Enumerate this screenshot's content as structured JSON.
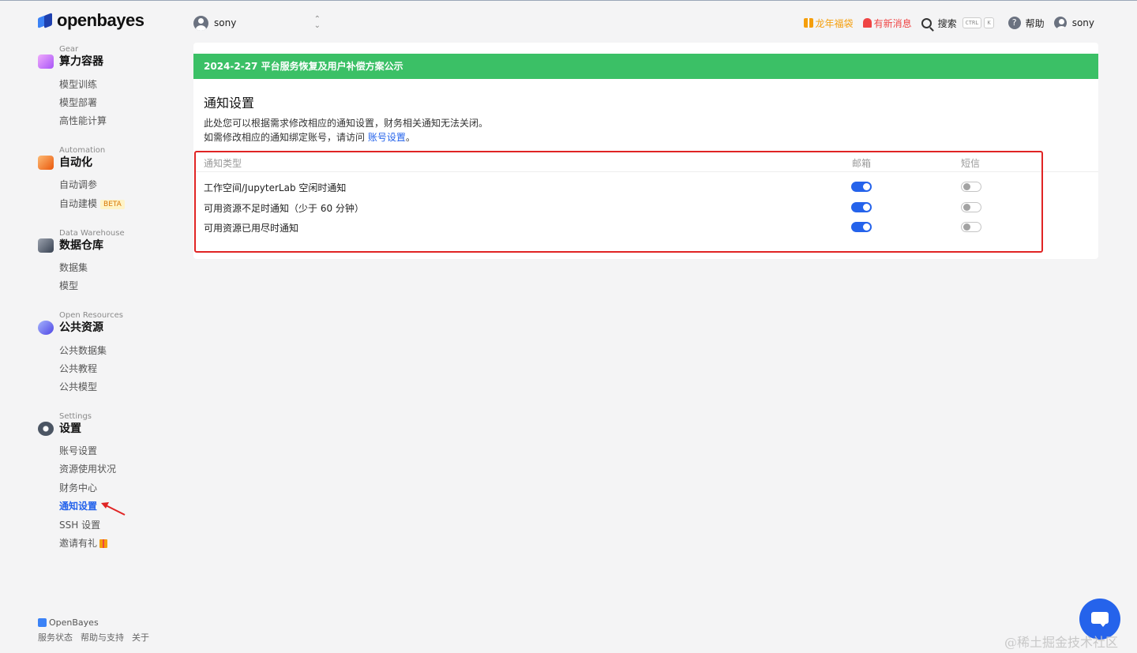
{
  "app": {
    "logo_text": "openbayes"
  },
  "workspace": {
    "name": "sony"
  },
  "topbar": {
    "gift_label": "龙年福袋",
    "news_label": "有新消息",
    "search_label": "搜索",
    "kbd_ctrl": "CTRL",
    "kbd_k": "K",
    "help_label": "帮助",
    "user_name": "sony",
    "gift_color": "#f59e0b",
    "news_color": "#ef4444"
  },
  "sidebar": {
    "sections": [
      {
        "sub": "Gear",
        "title": "算力容器",
        "icon": "container-icon",
        "items": [
          "模型训练",
          "模型部署",
          "高性能计算"
        ]
      },
      {
        "sub": "Automation",
        "title": "自动化",
        "icon": "automation-icon",
        "items": [
          "自动调参",
          "自动建模"
        ],
        "badge": "BETA"
      },
      {
        "sub": "Data Warehouse",
        "title": "数据仓库",
        "icon": "database-icon",
        "items": [
          "数据集",
          "模型"
        ]
      },
      {
        "sub": "Open Resources",
        "title": "公共资源",
        "icon": "public-resources-icon",
        "items": [
          "公共数据集",
          "公共教程",
          "公共模型"
        ]
      },
      {
        "sub": "Settings",
        "title": "设置",
        "icon": "gear-icon",
        "items": [
          "账号设置",
          "资源使用状况",
          "财务中心",
          "通知设置",
          "SSH 设置",
          "邀请有礼"
        ],
        "active": "通知设置"
      }
    ]
  },
  "footer": {
    "brand": "OpenBayes",
    "links": [
      "服务状态",
      "帮助与支持",
      "关于"
    ]
  },
  "main": {
    "banner": "2024-2-27 平台服务恢复及用户补偿方案公示",
    "banner_color": "#3bc066",
    "title": "通知设置",
    "desc1": "此处您可以根据需求修改相应的通知设置，财务相关通知无法关闭。",
    "desc2_prefix": "如需修改相应的通知绑定账号，请访问 ",
    "desc2_link": "账号设置",
    "desc2_suffix": "。",
    "table": {
      "headers": {
        "type": "通知类型",
        "email": "邮箱",
        "sms": "短信"
      },
      "rows": [
        {
          "label": "工作空间/JupyterLab 空闲时通知",
          "email": true,
          "sms": false
        },
        {
          "label": "可用资源不足时通知（少于 60 分钟）",
          "email": true,
          "sms": false
        },
        {
          "label": "可用资源已用尽时通知",
          "email": true,
          "sms": false
        }
      ]
    }
  },
  "watermark": "@稀土掘金技术社区"
}
